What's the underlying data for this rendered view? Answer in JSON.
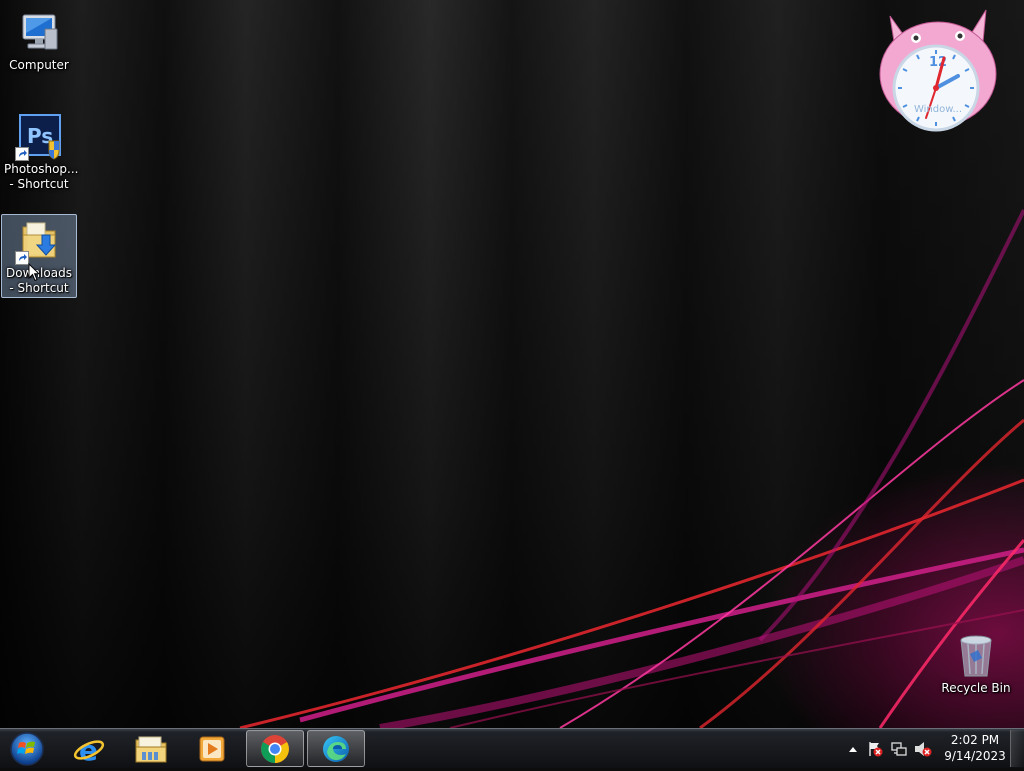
{
  "desktop": {
    "icons": [
      {
        "label": "Computer",
        "icon": "computer-icon"
      },
      {
        "label": "Photoshop... - Shortcut",
        "icon": "photoshop-icon"
      },
      {
        "label": "Downloads - Shortcut",
        "icon": "downloads-folder-icon",
        "selected": true
      },
      {
        "label": "Recycle Bin",
        "icon": "recycle-bin-icon"
      }
    ],
    "photoshop_glyph": "Ps"
  },
  "gadget": {
    "type": "clock",
    "brand_text": "Window..."
  },
  "taskbar": {
    "start": {
      "icon": "windows-orb-icon"
    },
    "pinned": [
      {
        "app": "Internet Explorer",
        "icon": "ie-icon",
        "running": false
      },
      {
        "app": "File Explorer",
        "icon": "folder-icon",
        "running": false
      },
      {
        "app": "Media Player",
        "icon": "media-player-icon",
        "running": false
      },
      {
        "app": "Google Chrome",
        "icon": "chrome-icon",
        "running": true
      },
      {
        "app": "Microsoft Edge",
        "icon": "edge-icon",
        "running": true
      }
    ],
    "tray": {
      "icons": [
        "show-hidden-icons-icon",
        "action-center-icon",
        "network-icon",
        "volume-muted-icon"
      ],
      "time": "2:02 PM",
      "date": "9/14/2023"
    }
  },
  "colors": {
    "accent_magenta": "#d0208a",
    "accent_red": "#e0262e",
    "taskbar": "#17191d"
  }
}
